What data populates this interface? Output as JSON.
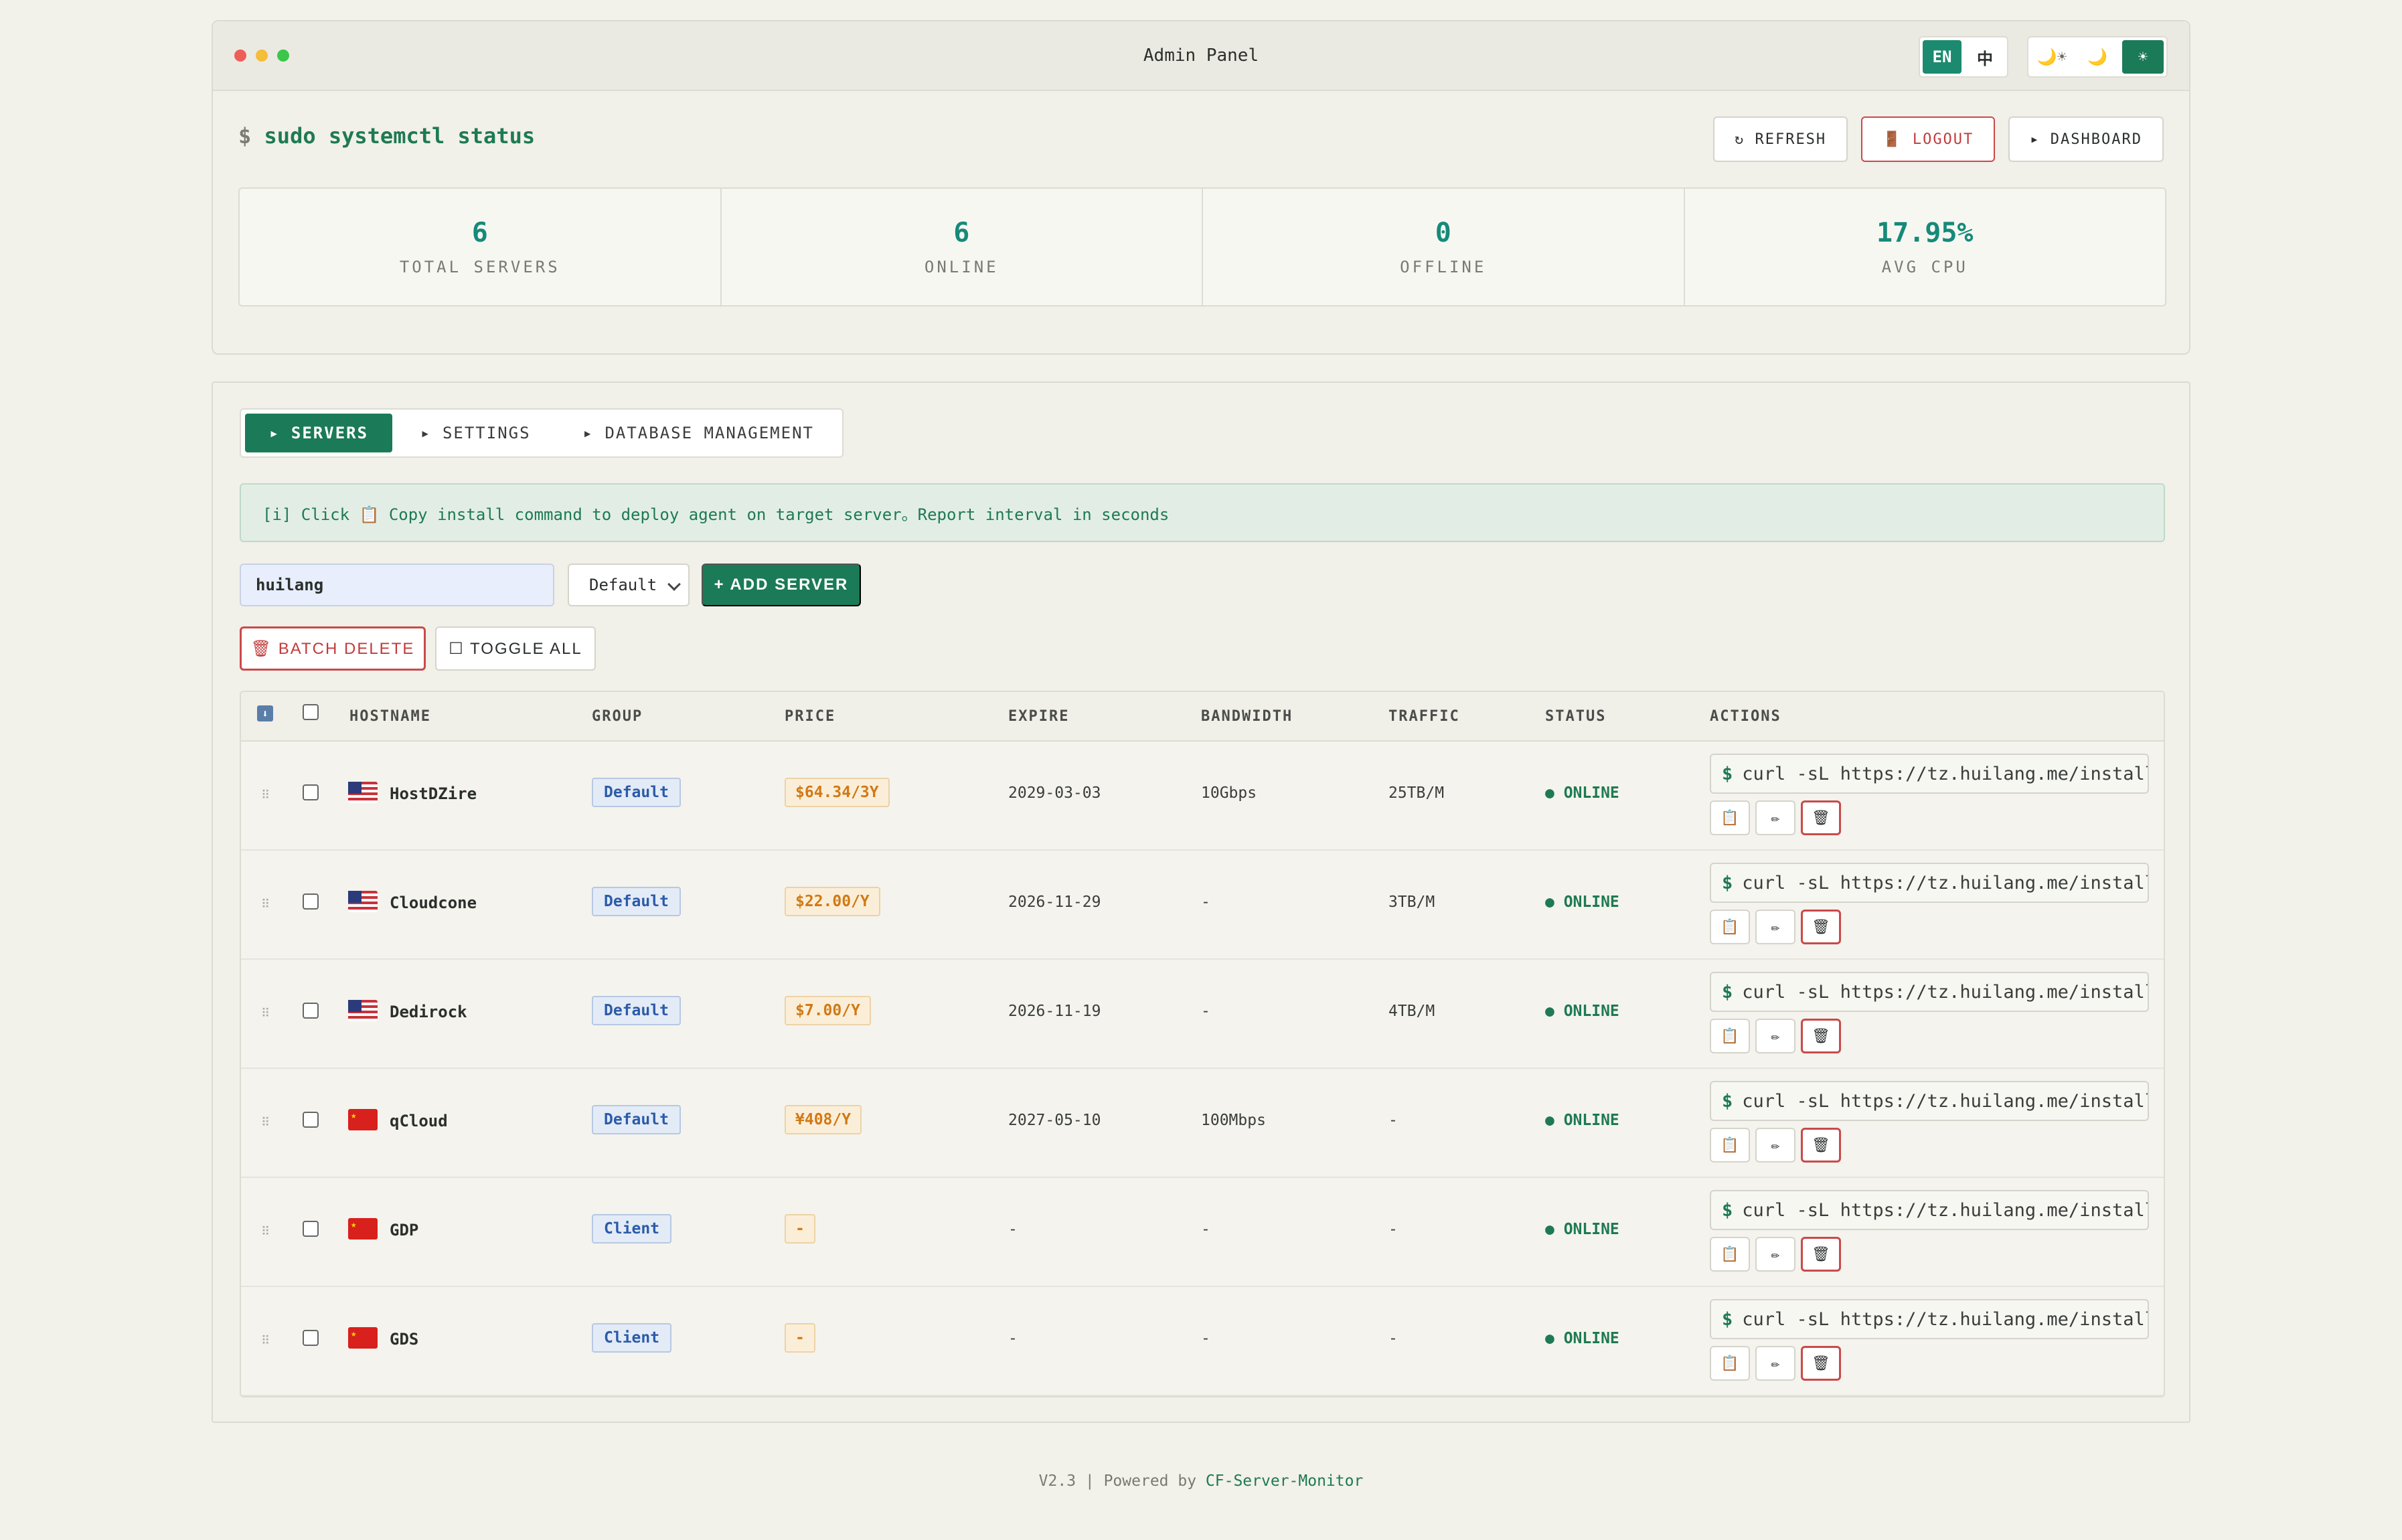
{
  "window": {
    "title": "Admin Panel"
  },
  "lang": {
    "en": "EN",
    "zh": "中"
  },
  "theme": {
    "auto": "🌙☀",
    "dark": "🌙",
    "light": "☀"
  },
  "header": {
    "prompt_sign": "$",
    "prompt_cmd": "sudo systemctl status",
    "refresh": "↻ REFRESH",
    "logout": "🚪 LOGOUT",
    "dashboard": "▸ DASHBOARD"
  },
  "stats": [
    {
      "value": "6",
      "label": "TOTAL SERVERS"
    },
    {
      "value": "6",
      "label": "ONLINE"
    },
    {
      "value": "0",
      "label": "OFFLINE"
    },
    {
      "value": "17.95%",
      "label": "AVG CPU"
    }
  ],
  "tabs": [
    "▸ SERVERS",
    "▸ SETTINGS",
    "▸ DATABASE MANAGEMENT"
  ],
  "info": "[i] Click 📋 Copy install command to deploy agent on target server。Report interval in seconds",
  "filter": {
    "search_value": "huilang",
    "group_select": "Default",
    "add_server": "+ ADD SERVER"
  },
  "bulk": {
    "batch_delete": "🗑 BATCH DELETE",
    "toggle_all": "☐ TOGGLE ALL"
  },
  "columns": [
    "HOSTNAME",
    "GROUP",
    "PRICE",
    "EXPIRE",
    "BANDWIDTH",
    "TRAFFIC",
    "STATUS",
    "ACTIONS"
  ],
  "rows": [
    {
      "flag": "us",
      "host": "HostDZire",
      "group": "Default",
      "price": "$64.34/3Y",
      "expire": "2029-03-03",
      "bandwidth": "10Gbps",
      "traffic": "25TB/M",
      "status": "● ONLINE",
      "cmd": "curl -sL https://tz.huilang.me/install."
    },
    {
      "flag": "us",
      "host": "Cloudcone",
      "group": "Default",
      "price": "$22.00/Y",
      "expire": "2026-11-29",
      "bandwidth": "-",
      "traffic": "3TB/M",
      "status": "● ONLINE",
      "cmd": "curl -sL https://tz.huilang.me/install."
    },
    {
      "flag": "us",
      "host": "Dedirock",
      "group": "Default",
      "price": "$7.00/Y",
      "expire": "2026-11-19",
      "bandwidth": "-",
      "traffic": "4TB/M",
      "status": "● ONLINE",
      "cmd": "curl -sL https://tz.huilang.me/install."
    },
    {
      "flag": "cn",
      "host": "qCloud",
      "group": "Default",
      "price": "¥408/Y",
      "expire": "2027-05-10",
      "bandwidth": "100Mbps",
      "traffic": "-",
      "status": "● ONLINE",
      "cmd": "curl -sL https://tz.huilang.me/install."
    },
    {
      "flag": "cn",
      "host": "GDP",
      "group": "Client",
      "price": "-",
      "expire": "-",
      "bandwidth": "-",
      "traffic": "-",
      "status": "● ONLINE",
      "cmd": "curl -sL https://tz.huilang.me/install."
    },
    {
      "flag": "cn",
      "host": "GDS",
      "group": "Client",
      "price": "-",
      "expire": "-",
      "bandwidth": "-",
      "traffic": "-",
      "status": "● ONLINE",
      "cmd": "curl -sL https://tz.huilang.me/install."
    }
  ],
  "actions": {
    "copy": "📋",
    "edit": "✏",
    "delete": "🗑"
  },
  "footer": {
    "version": "V2.3 | Powered by",
    "link": "CF-Server-Monitor"
  },
  "colors": {
    "accent": "#1b7a57",
    "teal": "#168a7a",
    "danger": "#c94a4a",
    "price": "#d07a14",
    "group": "#2c5ba8"
  }
}
